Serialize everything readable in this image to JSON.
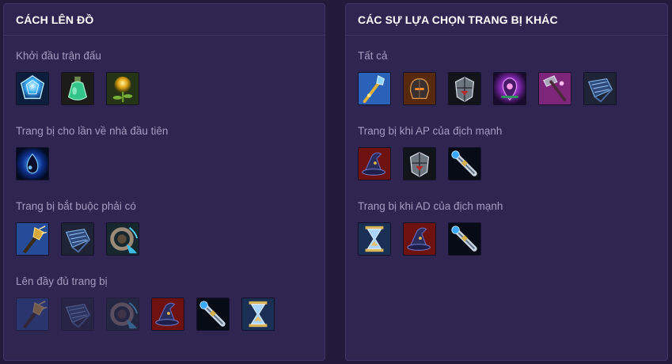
{
  "left_panel": {
    "title": "CÁCH LÊN ĐỒ",
    "sections": [
      {
        "title": "Khởi đầu trận đấu",
        "items": [
          "blue-gem-icon",
          "green-potion-icon",
          "sun-flower-icon"
        ]
      },
      {
        "title": "Trang bị cho lần về nhà đầu tiên",
        "items": [
          "dark-seal-icon"
        ]
      },
      {
        "title": "Trang bị bắt buộc phải có",
        "items": [
          "gold-staff-claw-icon",
          "blue-gauntlet-icon",
          "spiral-boots-icon"
        ]
      },
      {
        "title": "Lên đầy đủ trang bị",
        "items": [
          "gold-staff-claw-icon",
          "blue-gauntlet-icon",
          "spiral-boots-icon",
          "red-wizard-hat-icon",
          "blue-telescope-staff-icon",
          "hourglass-icon"
        ],
        "dimmed_count": 3
      }
    ]
  },
  "right_panel": {
    "title": "CÁC SỰ LỰA CHỌN TRANG BỊ KHÁC",
    "sections": [
      {
        "title": "Tất cả",
        "items": [
          "golden-sceptre-icon",
          "dark-helmet-icon",
          "silver-armor-icon",
          "purple-crystal-icon",
          "pink-hammer-icon",
          "blue-gauntlet-icon"
        ]
      },
      {
        "title": "Trang bị khi AP của địch mạnh",
        "items": [
          "red-wizard-hat-icon",
          "silver-armor-icon",
          "blue-telescope-staff-icon"
        ]
      },
      {
        "title": "Trang bị khi AD của địch mạnh",
        "items": [
          "hourglass-icon",
          "red-wizard-hat-icon",
          "blue-telescope-staff-icon"
        ]
      }
    ]
  },
  "colors": {
    "background": "#211a3a",
    "panel": "#2e2650",
    "border": "#3d3466",
    "heading": "#ffffff",
    "muted_text": "#a49cbf"
  }
}
